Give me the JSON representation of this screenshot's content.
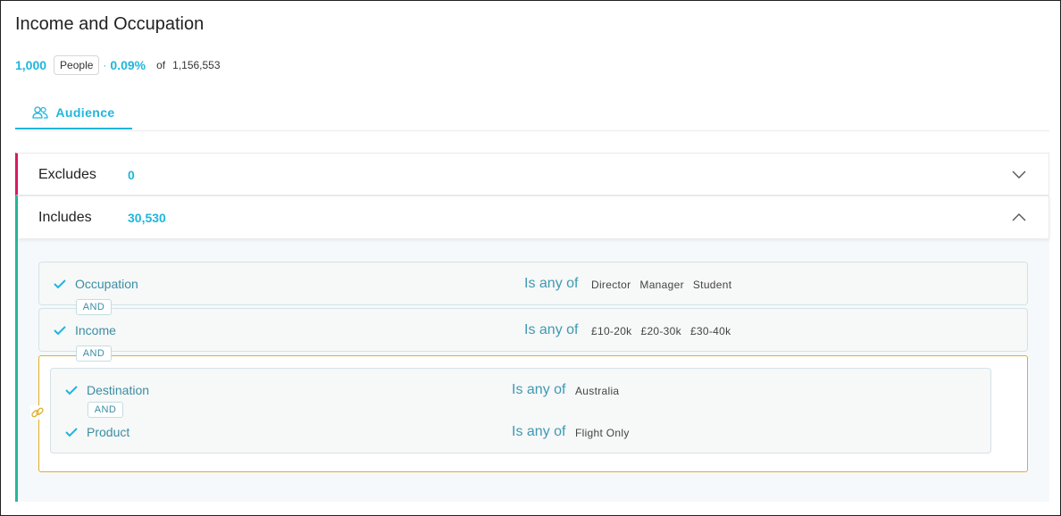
{
  "header": {
    "title": "Income and Occupation"
  },
  "stats": {
    "count": "1,000",
    "unit": "People",
    "separator": "·",
    "percent": "0.09%",
    "of_label": "of",
    "total": "1,156,553"
  },
  "tabs": [
    {
      "label": "Audience",
      "icon": "people-icon",
      "active": true
    }
  ],
  "excludes": {
    "label": "Excludes",
    "count": "0",
    "expanded": false
  },
  "includes": {
    "label": "Includes",
    "count": "30,530",
    "expanded": true,
    "rules": [
      {
        "field": "Occupation",
        "operator": "Is any of",
        "values": [
          "Director",
          "Manager",
          "Student"
        ]
      },
      {
        "field": "Income",
        "operator": "Is any of",
        "values": [
          "£10-20k",
          "£20-30k",
          "£30-40k"
        ]
      }
    ],
    "connectors": [
      "AND",
      "AND"
    ],
    "group": {
      "connector": "AND",
      "rules": [
        {
          "field": "Destination",
          "operator": "Is any of",
          "values": [
            "Australia"
          ]
        },
        {
          "field": "Product",
          "operator": "Is any of",
          "values": [
            "Flight Only"
          ]
        }
      ]
    }
  },
  "colors": {
    "accent": "#1fb6dd",
    "exclude_border": "#d81b60",
    "include_border": "#26b89a",
    "group_border": "#e1ab2b"
  }
}
